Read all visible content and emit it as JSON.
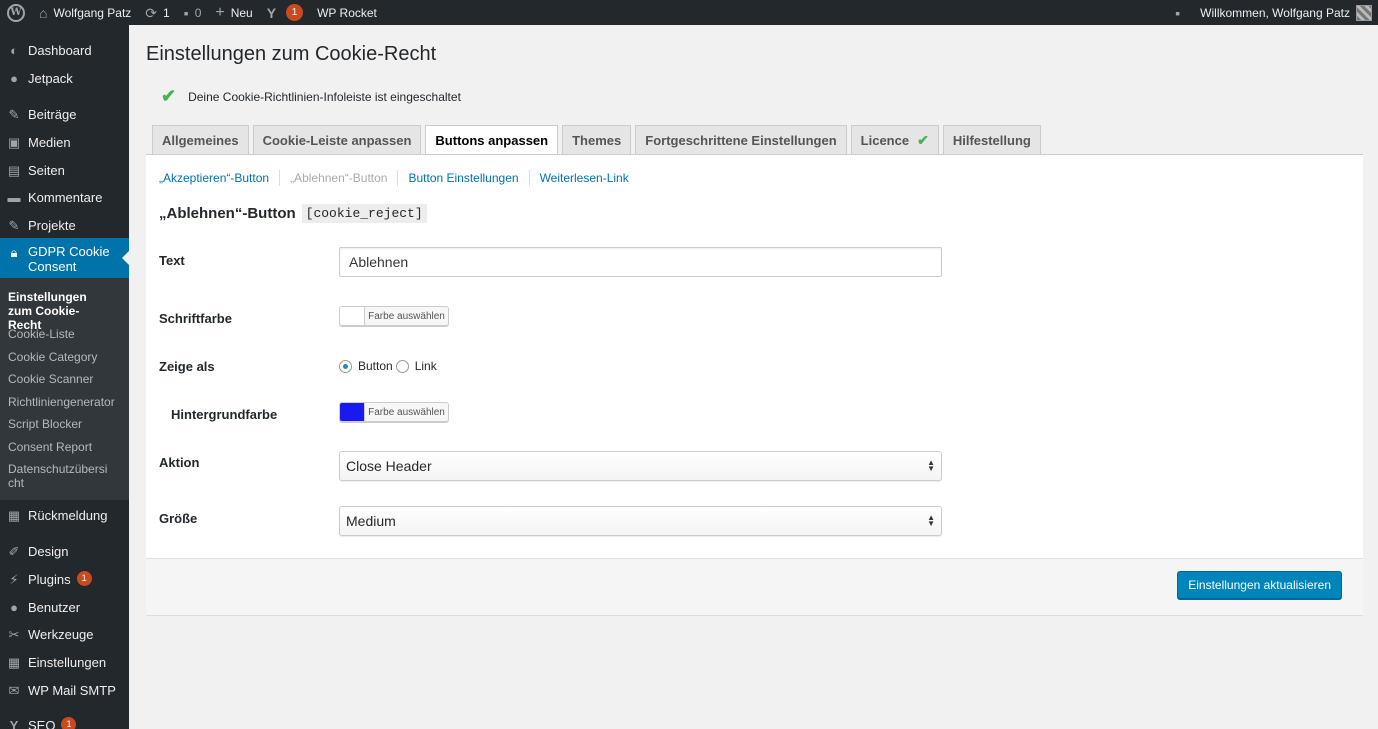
{
  "adminbar": {
    "site_name": "Wolfgang Patz",
    "updates_count": "1",
    "comments_count": "0",
    "new_label": "Neu",
    "yoast_badge": "1",
    "wp_rocket": "WP Rocket",
    "welcome": "Willkommen, Wolfgang Patz"
  },
  "sidebar": {
    "items": [
      {
        "label": "Dashboard",
        "icon": "dashboard-icon"
      },
      {
        "label": "Jetpack",
        "icon": "jetpack-icon"
      },
      {
        "label": "Beiträge",
        "icon": "pin-icon"
      },
      {
        "label": "Medien",
        "icon": "media-icon"
      },
      {
        "label": "Seiten",
        "icon": "page-icon"
      },
      {
        "label": "Kommentare",
        "icon": "comment-icon"
      },
      {
        "label": "Projekte",
        "icon": "pin-icon"
      },
      {
        "label": "GDPR Cookie Consent",
        "icon": "lock-icon"
      },
      {
        "label": "Rückmeldung",
        "icon": "feedback-icon"
      },
      {
        "label": "Design",
        "icon": "brush-icon"
      },
      {
        "label": "Plugins",
        "icon": "plugin-icon",
        "badge": "1"
      },
      {
        "label": "Benutzer",
        "icon": "user-icon"
      },
      {
        "label": "Werkzeuge",
        "icon": "wrench-icon"
      },
      {
        "label": "Einstellungen",
        "icon": "settings-icon"
      },
      {
        "label": "WP Mail SMTP",
        "icon": "mail-icon"
      },
      {
        "label": "SEO",
        "icon": "yoast-icon",
        "badge": "1"
      }
    ],
    "submenu": [
      "Einstellungen zum Cookie-Recht",
      "Cookie-Liste",
      "Cookie Category",
      "Cookie Scanner",
      "Richtliniengenerator",
      "Script Blocker",
      "Consent Report",
      "Datenschutzübersicht"
    ]
  },
  "page": {
    "title": "Einstellungen zum Cookie-Recht",
    "notice": "Deine Cookie-Richtlinien-Infoleiste ist eingeschaltet"
  },
  "tabs": [
    "Allgemeines",
    "Cookie-Leiste anpassen",
    "Buttons anpassen",
    "Themes",
    "Fortgeschrittene Einstellungen",
    "Licence",
    "Hilfestellung"
  ],
  "subnav": [
    "„Akzeptieren“-Button",
    "„Ablehnen“-Button",
    "Button Einstellungen",
    "Weiterlesen-Link"
  ],
  "section": {
    "title": "„Ablehnen“-Button",
    "code": "[cookie_reject]"
  },
  "form": {
    "text_label": "Text",
    "text_value": "Ablehnen",
    "font_color_label": "Schriftfarbe",
    "font_color": "#ffffff",
    "choose_color": "Farbe auswählen",
    "show_as_label": "Zeige als",
    "show_as_button": "Button",
    "show_as_link": "Link",
    "bg_color_label": "Hintergrundfarbe",
    "bg_color": "#1a1aef",
    "action_label": "Aktion",
    "action_value": "Close Header",
    "size_label": "Größe",
    "size_value": "Medium"
  },
  "footer": {
    "save_label": "Einstellungen aktualisieren"
  }
}
